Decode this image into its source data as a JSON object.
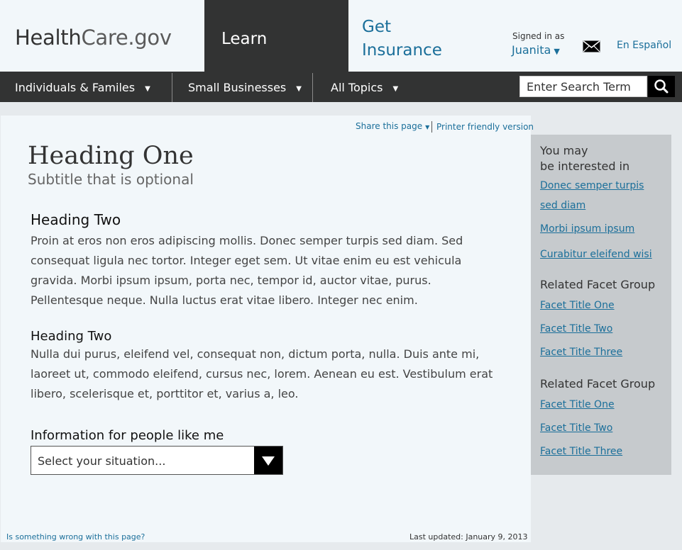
{
  "header": {
    "logo_part1": "Health",
    "logo_part2": "Care.gov",
    "learn": "Learn",
    "get_insurance": "Get Insurance",
    "signed_in_label": "Signed in as",
    "user_name": "Juanita",
    "espanol": "En Español"
  },
  "nav": {
    "items": [
      {
        "label": "Individuals & Familes"
      },
      {
        "label": "Small Businesses"
      },
      {
        "label": "All Topics"
      }
    ],
    "search_placeholder": "Enter Search Term"
  },
  "utility": {
    "share": "Share this page",
    "printer": "Printer friendly version"
  },
  "content": {
    "heading_one": "Heading One",
    "subtitle": "Subtitle that is optional",
    "section1_heading": "Heading Two",
    "section1_text": "Proin at eros non eros adipiscing mollis. Donec semper turpis sed diam. Sed consequat ligula nec tortor. Integer eget sem. Ut vitae enim eu est vehicula gravida. Morbi ipsum ipsum, porta nec, tempor id, auctor vitae, purus. Pellentesque neque. Nulla luctus erat vitae libero. Integer nec enim.",
    "section2_heading": "Heading Two",
    "section2_text": "Nulla dui purus, eleifend vel, consequat non, dictum porta, nulla. Duis ante mi, laoreet ut, commodo eleifend, cursus nec, lorem. Aenean eu est. Vestibulum erat libero, scelerisque et, porttitor et, varius a, leo.",
    "info_label": "Information for people like me",
    "select_value": "Select your situation..."
  },
  "footer": {
    "wrong": "Is something wrong with this page?",
    "updated": "Last updated: January 9, 2013"
  },
  "sidebar": {
    "interest_line1": "You may",
    "interest_line2": "be interested in",
    "interest_links": [
      "Donec semper turpis sed diam",
      "Morbi ipsum ipsum",
      "Curabitur eleifend wisi"
    ],
    "group1_title": "Related Facet Group",
    "group1_links": [
      "Facet Title One",
      "Facet Title Two",
      "Facet Title Three"
    ],
    "group2_title": "Related Facet Group",
    "group2_links": [
      "Facet Title One",
      "Facet Title Two",
      "Facet Title Three"
    ]
  }
}
